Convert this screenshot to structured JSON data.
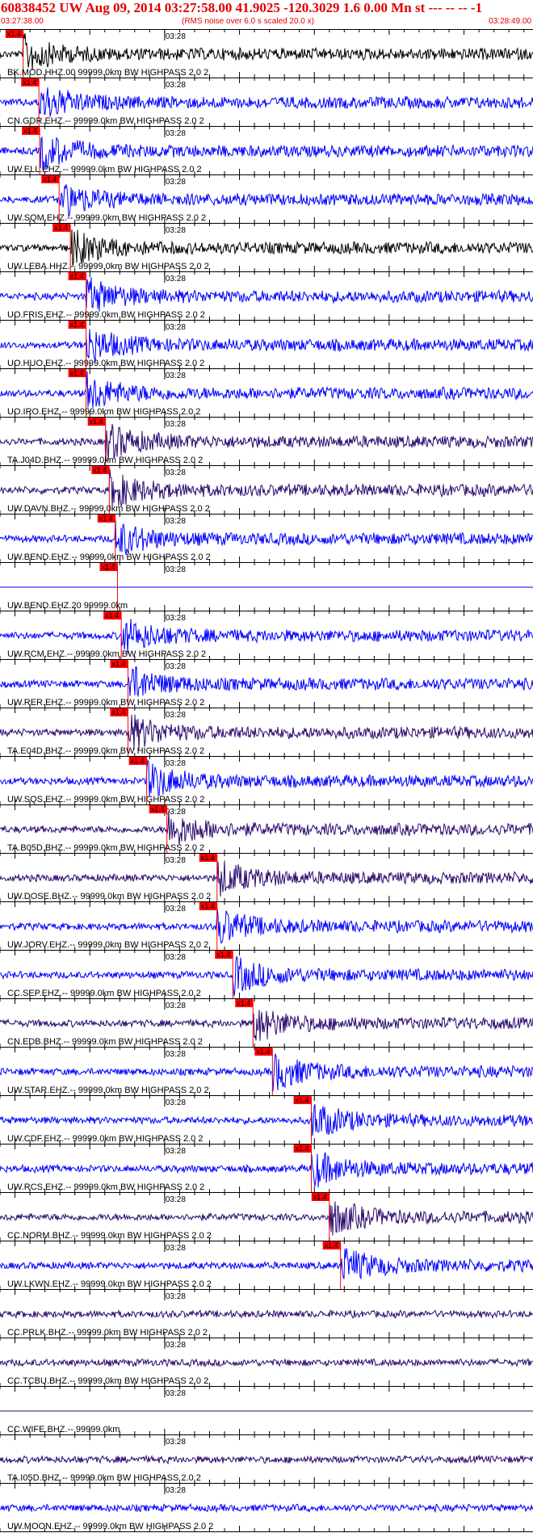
{
  "header": {
    "title": "60838452 UW Aug 09, 2014 03:27:58.00   41.9025 -120.3029  1.6 0.00 Mn st --- -- --  -1",
    "start_time": "03:27:38.00",
    "rms_note": "(RMS noise over 6.0 s scaled 20.0 x)",
    "end_time": "03:28:49.00"
  },
  "colors": {
    "header_red": "#e00000",
    "black": "#000000",
    "blue": "#0000ff",
    "navy": "#2a0a6e",
    "pick_red": "#ff0000"
  },
  "chart_data": {
    "type": "line",
    "title": "60838452 UW Aug 09, 2014 03:27:58.00   41.9025 -120.3029  1.6 0.00 Mn st --- -- --  -1",
    "x_start": "03:27:38.00",
    "x_end": "03:28:49.00",
    "minute_label": "03:28",
    "pick_label": "x1.4",
    "traces": [
      {
        "label": "BK.MOD.HHZ.00 99999.0km BW  HIGHPASS  2.0  2",
        "color": "black",
        "pick": 3.1
      },
      {
        "label": "CN.GDR.EHZ.-- 99999.0km BW  HIGHPASS  2.0  2",
        "color": "blue",
        "pick": 5.2
      },
      {
        "label": "UW.ELL.EHZ.-- 99999.0km BW  HIGHPASS  2.0  2",
        "color": "blue",
        "pick": 5.3
      },
      {
        "label": "UW.SQM.EHZ.-- 99999.0km BW  HIGHPASS  2.0  2",
        "color": "blue",
        "pick": 7.9
      },
      {
        "label": "UW.LEBA.HHZ.-- 99999.0km BW  HIGHPASS  2.0  2",
        "color": "black",
        "pick": 9.4
      },
      {
        "label": "UO.FRIS.EHZ.-- 99999.0km BW  HIGHPASS  2.0  2",
        "color": "blue",
        "pick": 11.5
      },
      {
        "label": "UO.HUO.EHZ.-- 99999.0km BW  HIGHPASS  2.0  2",
        "color": "blue",
        "pick": 11.5
      },
      {
        "label": "UO.IRO.EHZ.-- 99999.0km BW  HIGHPASS  2.0  2",
        "color": "blue",
        "pick": 11.5
      },
      {
        "label": "TA.J04D.BHZ.-- 99999.0km BW  HIGHPASS  2.0  2",
        "color": "navy",
        "pick": 14.1
      },
      {
        "label": "UW.DAVN.BHZ.-- 99999.0km BW  HIGHPASS  2.0  2",
        "color": "navy",
        "pick": 14.6
      },
      {
        "label": "UW.BEND.EHZ.-- 99999.0km BW  HIGHPASS  2.0  2",
        "color": "blue",
        "pick": 15.4
      },
      {
        "label": "UW.BEND.EHZ.20 99999.0km",
        "color": "blue",
        "pick": 15.7,
        "flat": true
      },
      {
        "label": "UW.RCM.EHZ.-- 99999.0km BW  HIGHPASS  2.0  2",
        "color": "blue",
        "pick": 16.2
      },
      {
        "label": "UW.RER.EHZ.-- 99999.0km BW  HIGHPASS  2.0  2",
        "color": "blue",
        "pick": 17.1
      },
      {
        "label": "TA.E04D.BHZ.-- 99999.0km BW  HIGHPASS  2.0  2",
        "color": "navy",
        "pick": 17.1
      },
      {
        "label": "UW.SQS.EHZ.-- 99999.0km BW  HIGHPASS  2.0  2",
        "color": "blue",
        "pick": 19.6
      },
      {
        "label": "TA.B05D.BHZ.-- 99999.0km BW  HIGHPASS  2.0  2",
        "color": "navy",
        "pick": 22.3
      },
      {
        "label": "UW.DOSE.BHZ.-- 99999.0km BW  HIGHPASS  2.0  2",
        "color": "navy",
        "pick": 29.0
      },
      {
        "label": "UW.JORV.EHZ.-- 99999.0km BW  HIGHPASS  2.0  2",
        "color": "blue",
        "pick": 29.0
      },
      {
        "label": "CC.SEP.EHZ.-- 99999.0km BW  HIGHPASS  2.0  2",
        "color": "blue",
        "pick": 31.1
      },
      {
        "label": "CN.EDB.BHZ.-- 99999.0km BW  HIGHPASS  2.0  2",
        "color": "navy",
        "pick": 33.8
      },
      {
        "label": "UW.STAR.EHZ.-- 99999.0km BW  HIGHPASS  2.0  2",
        "color": "blue",
        "pick": 36.4
      },
      {
        "label": "UW.CDF.EHZ.-- 99999.0km BW  HIGHPASS  2.0  2",
        "color": "blue",
        "pick": 41.6
      },
      {
        "label": "UW.RCS.EHZ.-- 99999.0km BW  HIGHPASS  2.0  2",
        "color": "blue",
        "pick": 41.6
      },
      {
        "label": "CC.NORM.BHZ.-- 99999.0km BW  HIGHPASS  2.0  2",
        "color": "navy",
        "pick": 44.0
      },
      {
        "label": "UW.LKWN.EHZ.-- 99999.0km BW  HIGHPASS  2.0  2",
        "color": "blue",
        "pick": 45.5
      },
      {
        "label": "CC.PRLK.BHZ.-- 99999.0km BW  HIGHPASS  2.0  2",
        "color": "navy",
        "pick": null
      },
      {
        "label": "CC.TCBU.BHZ.-- 99999.0km BW  HIGHPASS  2.0  2",
        "color": "navy",
        "pick": null
      },
      {
        "label": "CC.WIFE.BHZ.-- 99999.0km",
        "color": "navy",
        "pick": null,
        "flat": true
      },
      {
        "label": "TA.I05D.BHZ.-- 99999.0km BW  HIGHPASS  2.0  2",
        "color": "navy",
        "pick": null
      },
      {
        "label": "UW.MOON.EHZ.-- 99999.0km BW  HIGHPASS  2.0  2",
        "color": "blue",
        "pick": null
      }
    ]
  }
}
